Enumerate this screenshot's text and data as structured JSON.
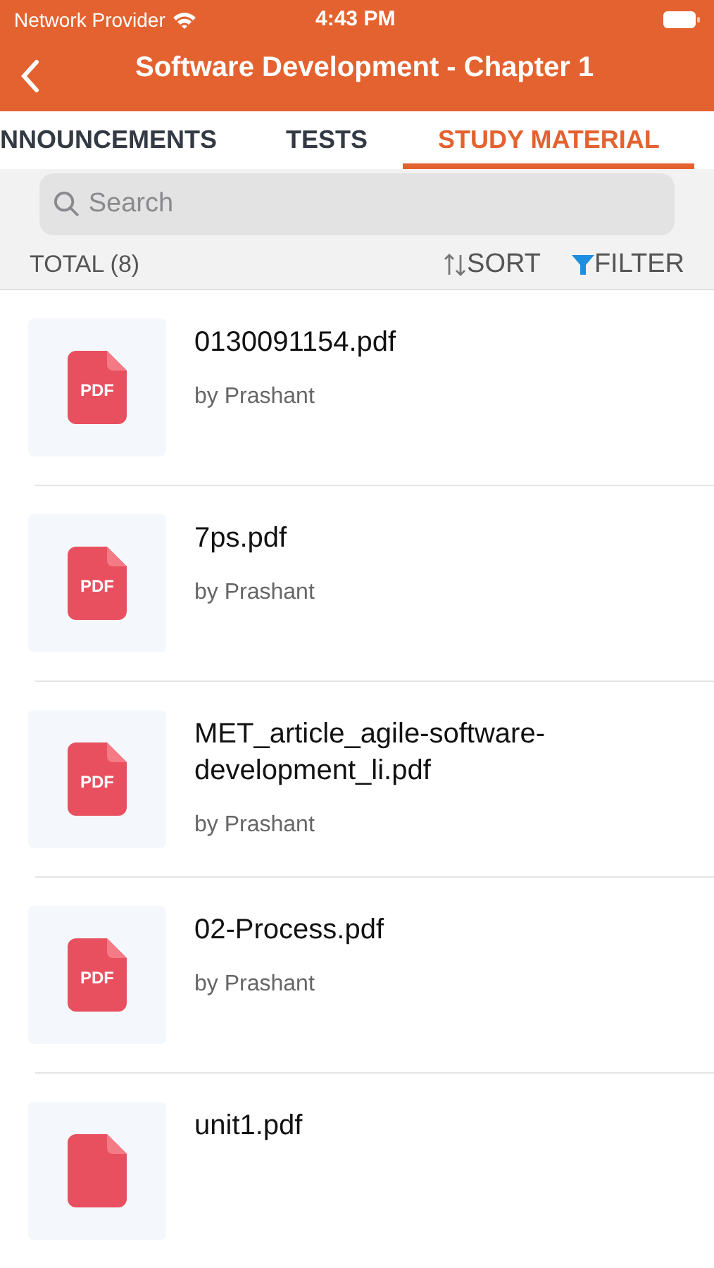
{
  "status_bar": {
    "carrier": "Network Provider",
    "time": "4:43 PM"
  },
  "header": {
    "title": "Software Development - Chapter 1"
  },
  "tabs": [
    {
      "label": "NNOUNCEMENTS",
      "selected": false
    },
    {
      "label": "TESTS",
      "selected": false
    },
    {
      "label": "STUDY MATERIAL",
      "selected": true
    }
  ],
  "search": {
    "placeholder": "Search"
  },
  "toolbar": {
    "total": "TOTAL (8)",
    "sort": "SORT",
    "filter": "FILTER"
  },
  "files": [
    {
      "title": "0130091154.pdf",
      "author": "by Prashant",
      "icon_label": "PDF"
    },
    {
      "title": "7ps.pdf",
      "author": "by Prashant",
      "icon_label": "PDF"
    },
    {
      "title": "MET_article_agile-software-development_li.pdf",
      "author": "by Prashant",
      "icon_label": "PDF"
    },
    {
      "title": "02-Process.pdf",
      "author": "by Prashant",
      "icon_label": "PDF"
    },
    {
      "title": "unit1.pdf"
    }
  ]
}
